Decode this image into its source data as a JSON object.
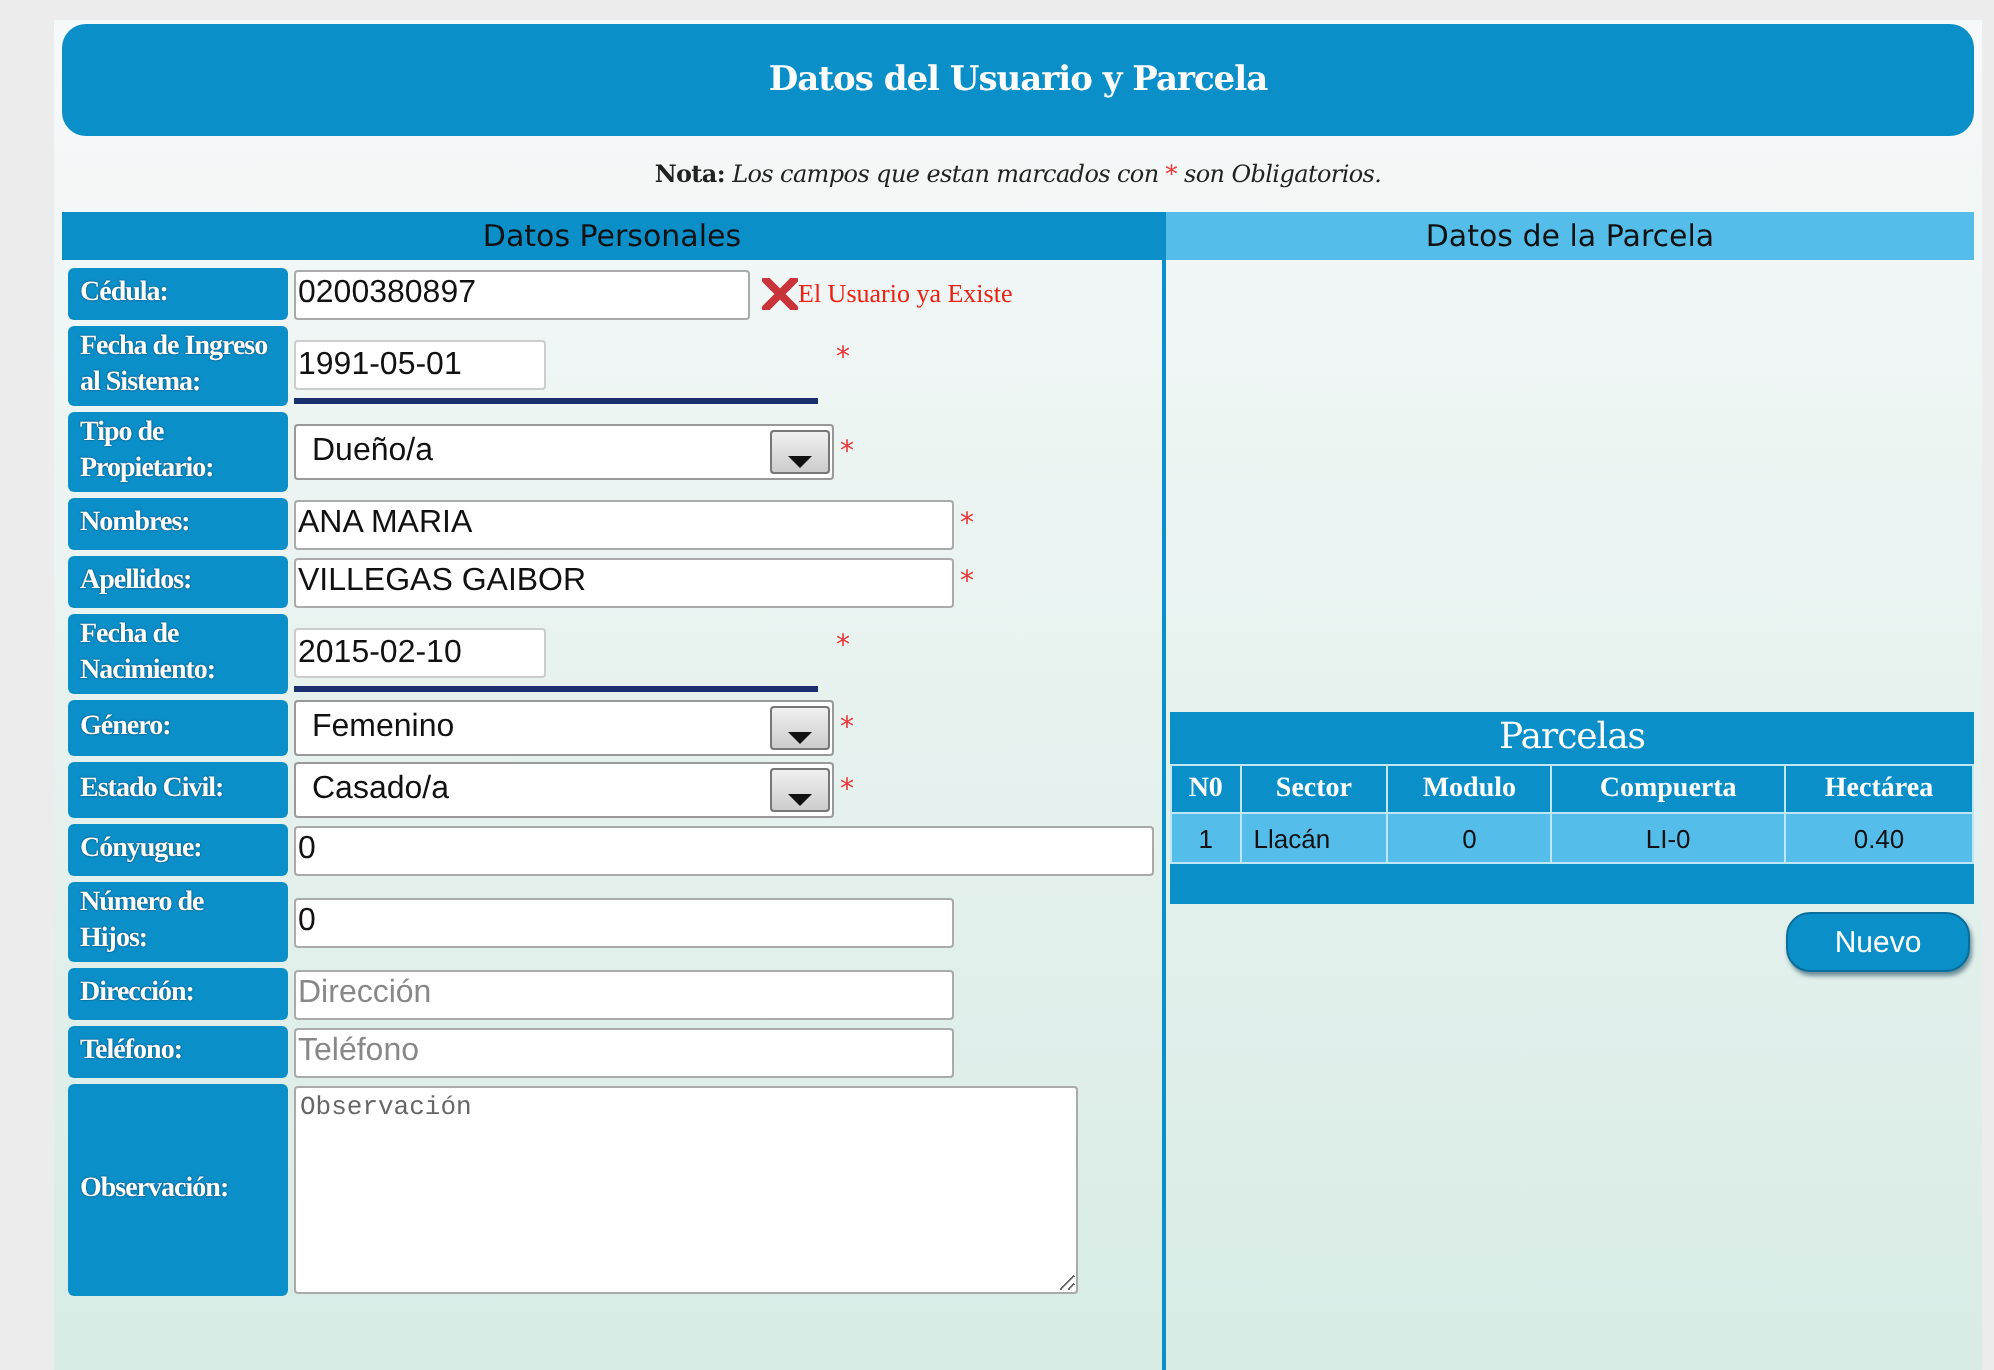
{
  "header": {
    "title": "Datos del Usuario y Parcela"
  },
  "note": {
    "label": "Nota:",
    "message_before": "Los campos que estan marcados con",
    "mark": "*",
    "message_after": "son Obligatorios."
  },
  "personal": {
    "title": "Datos Personales",
    "fields": [
      {
        "kind": "text",
        "label": "Cédula:",
        "value": "0200380897",
        "required": false,
        "error": "El Usuario ya Existe"
      },
      {
        "kind": "date",
        "label": "Fecha de Ingreso al Sistema:",
        "value": "1991-05-01",
        "required": true
      },
      {
        "kind": "select",
        "label": "Tipo de Propietario:",
        "value": "Dueño/a",
        "required": true
      },
      {
        "kind": "text",
        "label": "Nombres:",
        "value": "ANA MARIA",
        "required": true
      },
      {
        "kind": "text",
        "label": "Apellidos:",
        "value": "VILLEGAS GAIBOR",
        "required": true
      },
      {
        "kind": "date",
        "label": "Fecha de Nacimiento:",
        "value": "2015-02-10",
        "required": true
      },
      {
        "kind": "select",
        "label": "Género:",
        "value": "Femenino",
        "required": true
      },
      {
        "kind": "select",
        "label": "Estado Civil:",
        "value": "Casado/a",
        "required": true
      },
      {
        "kind": "text",
        "label": "Cónyugue:",
        "value": "0",
        "required": false
      },
      {
        "kind": "text",
        "label": "Número de Hijos:",
        "value": "0",
        "required": false
      },
      {
        "kind": "text",
        "label": "Dirección:",
        "placeholder": "Dirección",
        "required": false
      },
      {
        "kind": "text",
        "label": "Teléfono:",
        "placeholder": "Teléfono",
        "required": false
      },
      {
        "kind": "textarea",
        "label": "Observación:",
        "placeholder": "Observación",
        "required": false
      }
    ]
  },
  "parcel": {
    "title": "Datos de la Parcela",
    "table": {
      "title": "Parcelas",
      "columns": [
        "N0",
        "Sector",
        "Modulo",
        "Compuerta",
        "Hectárea"
      ],
      "rows": [
        [
          "1",
          "Llacán",
          "0",
          "LI-0",
          "0.40"
        ]
      ]
    },
    "button": "Nuevo"
  }
}
